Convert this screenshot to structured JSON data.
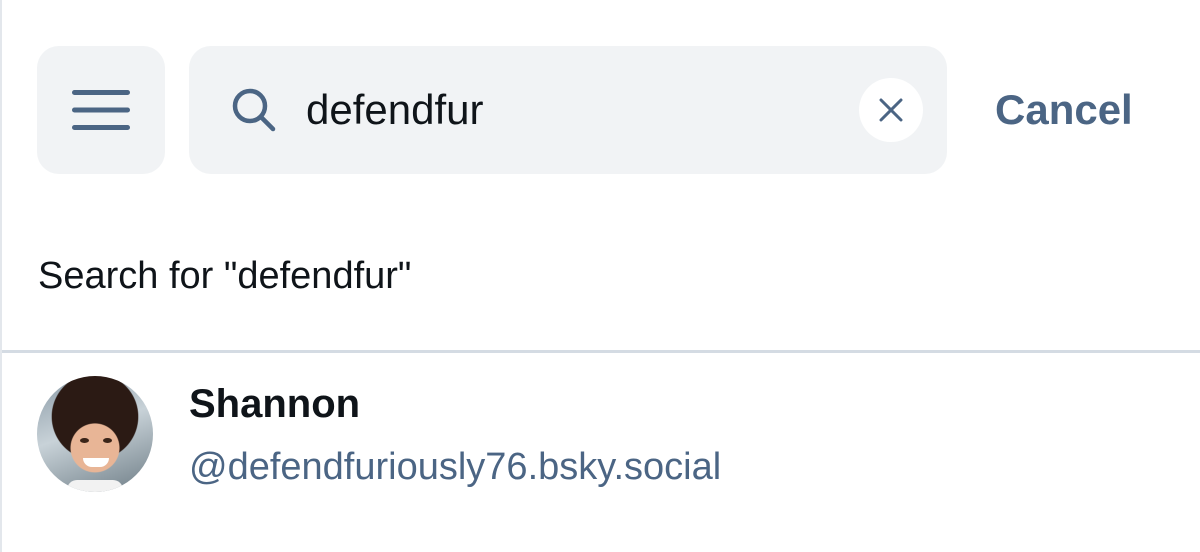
{
  "header": {
    "menu_icon": "hamburger-menu-icon",
    "search": {
      "icon": "search-icon",
      "value": "defendfur",
      "clear_icon": "close-icon"
    },
    "cancel_label": "Cancel"
  },
  "search_suggestion": "Search for \"defendfur\"",
  "results": [
    {
      "display_name": "Shannon",
      "handle": "@defendfuriously76.bsky.social"
    }
  ],
  "colors": {
    "accent": "#4b6584",
    "input_bg": "#f1f3f5",
    "divider": "#d4dbe3",
    "text": "#0f1419"
  }
}
